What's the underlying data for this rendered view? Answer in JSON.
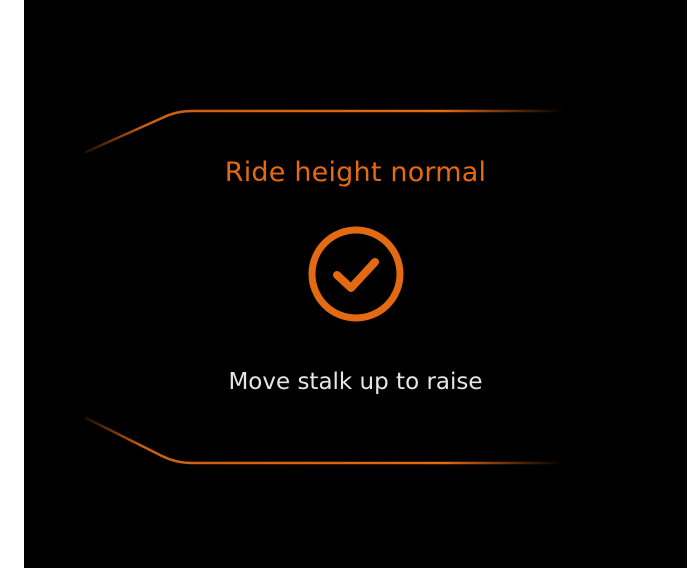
{
  "notification": {
    "title": "Ride height normal",
    "subtitle": "Move stalk up to raise",
    "status_icon": "check-circle-icon"
  },
  "colors": {
    "accent": "#E36A12",
    "title": "#E36A12",
    "subtitle": "#E6E6E6",
    "background": "#000000"
  }
}
